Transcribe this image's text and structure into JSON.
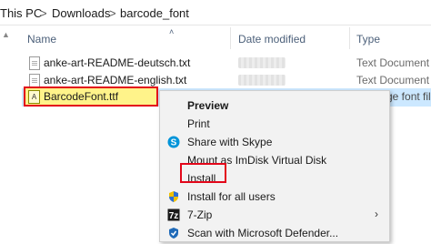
{
  "breadcrumb": {
    "items": [
      "This PC",
      "Downloads",
      "barcode_font"
    ],
    "separator": ">"
  },
  "columns": {
    "name": "Name",
    "date": "Date modified",
    "type": "Type"
  },
  "files": [
    {
      "name": "anke-art-README-deutsch.txt",
      "type": "Text Document",
      "icon": "text-file-icon"
    },
    {
      "name": "anke-art-README-english.txt",
      "type": "Text Document",
      "icon": "text-file-icon"
    },
    {
      "name": "BarcodeFont.ttf",
      "type": "ge font file",
      "icon": "font-file-icon",
      "selected": true
    }
  ],
  "context_menu": {
    "items": [
      {
        "label": "Preview",
        "bold": true
      },
      {
        "label": "Print"
      },
      {
        "label": "Share with Skype",
        "icon": "skype-icon"
      },
      {
        "label": "Mount as ImDisk Virtual Disk"
      },
      {
        "label": "Install",
        "highlighted": true
      },
      {
        "label": "Install for all users",
        "icon": "shield-icon"
      },
      {
        "label": "7-Zip",
        "icon": "7zip-icon",
        "submenu": true
      },
      {
        "label": "Scan with Microsoft Defender...",
        "icon": "defender-icon"
      }
    ]
  },
  "colors": {
    "highlight_box": "#e3071a",
    "selection": "#cce8ff",
    "selected_name_bg": "#fff38a"
  }
}
